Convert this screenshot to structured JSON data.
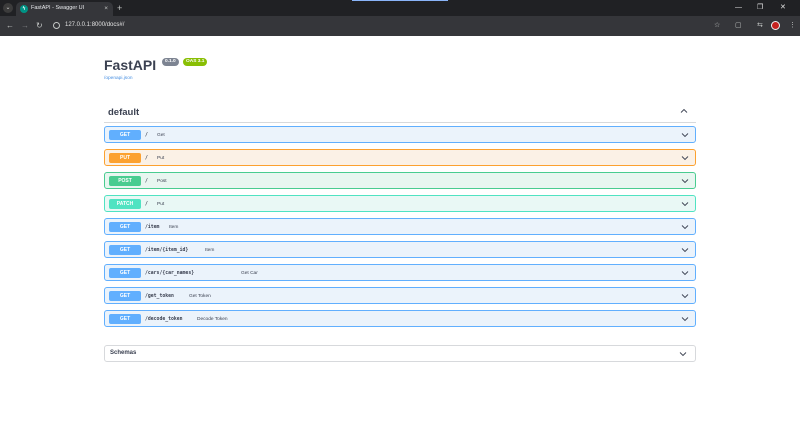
{
  "browser": {
    "tab_title": "FastAPI - Swagger UI",
    "tab_close": "×",
    "new_tab": "+",
    "url": "127.0.0.1:8000/docs#/",
    "window_minimize": "—",
    "window_restore": "❐",
    "window_close": "✕"
  },
  "app": {
    "title": "FastAPI",
    "version": "0.1.0",
    "oas": "OAS 3.1",
    "openapi_link": "/openapi.json"
  },
  "section": {
    "name": "default"
  },
  "operations": [
    {
      "method": "GET",
      "path": "/",
      "summary": "Get",
      "color": "#61affe",
      "bg": "#ebf3fb"
    },
    {
      "method": "PUT",
      "path": "/",
      "summary": "Put",
      "color": "#fca130",
      "bg": "#fbf1e6"
    },
    {
      "method": "POST",
      "path": "/",
      "summary": "Post",
      "color": "#49cc90",
      "bg": "#e8f6f0"
    },
    {
      "method": "PATCH",
      "path": "/",
      "summary": "Put",
      "color": "#50e3c2",
      "bg": "#e9f8f5"
    },
    {
      "method": "GET",
      "path": "/item",
      "summary": "Item",
      "color": "#61affe",
      "bg": "#ebf3fb"
    },
    {
      "method": "GET",
      "path": "/item/{item_id}",
      "summary": "Item",
      "color": "#61affe",
      "bg": "#ebf3fb"
    },
    {
      "method": "GET",
      "path": "/cars/{car_names}",
      "summary": "Get Car",
      "color": "#61affe",
      "bg": "#ebf3fb"
    },
    {
      "method": "GET",
      "path": "/get_token",
      "summary": "Get Token",
      "color": "#61affe",
      "bg": "#ebf3fb"
    },
    {
      "method": "GET",
      "path": "/decode_token",
      "summary": "Decode Token",
      "color": "#61affe",
      "bg": "#ebf3fb"
    }
  ],
  "schemas": {
    "label": "Schemas"
  },
  "icons": {
    "tab_search": "chevron-down-icon",
    "back": "arrow-left-icon",
    "forward": "arrow-right-icon",
    "reload": "reload-icon",
    "bookmark": "star-icon",
    "extensions": "puzzle-icon",
    "menu": "kebab-icon"
  }
}
